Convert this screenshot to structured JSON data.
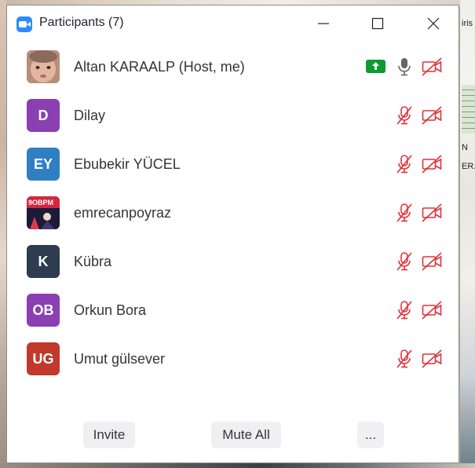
{
  "window": {
    "title": "Participants (7)"
  },
  "participants": [
    {
      "name": "Altan KARAALP (Host, me)",
      "initials": "",
      "avatar_color": "#c89a82",
      "photo": true,
      "mic_muted": false,
      "video_off": true,
      "sharing_badge": true
    },
    {
      "name": "Dilay",
      "initials": "D",
      "avatar_color": "#8a3fb3",
      "mic_muted": true,
      "video_off": true
    },
    {
      "name": "Ebubekir YÜCEL",
      "initials": "EY",
      "avatar_color": "#2f7fc1",
      "mic_muted": true,
      "video_off": true
    },
    {
      "name": "emrecanpoyraz",
      "initials": "",
      "avatar_color": "#d42640",
      "photo": true,
      "avatar_text": "9OBPM",
      "mic_muted": true,
      "video_off": true
    },
    {
      "name": "Kübra",
      "initials": "K",
      "avatar_color": "#2e3c4f",
      "mic_muted": true,
      "video_off": true
    },
    {
      "name": "Orkun Bora",
      "initials": "OB",
      "avatar_color": "#8a3fb3",
      "mic_muted": true,
      "video_off": true
    },
    {
      "name": "Umut gülsever",
      "initials": "UG",
      "avatar_color": "#c0392b",
      "mic_muted": true,
      "video_off": true
    }
  ],
  "footer": {
    "invite_label": "Invite",
    "mute_all_label": "Mute All",
    "more_label": "..."
  },
  "colors": {
    "muted_red": "#e0313a",
    "share_green": "#0e9a2f",
    "zoom_blue": "#2d8cff"
  },
  "background": {
    "text_1": "iris",
    "text_2": "N",
    "text_3": "ER."
  }
}
